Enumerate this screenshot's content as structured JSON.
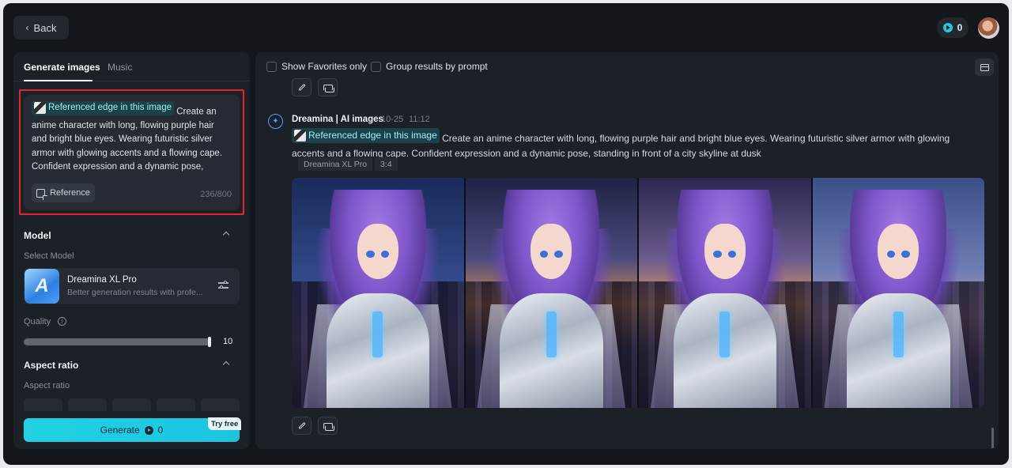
{
  "header": {
    "back_label": "Back",
    "credits": "0"
  },
  "left": {
    "tabs": [
      {
        "label": "Generate images",
        "active": true
      },
      {
        "label": "Music",
        "active": false
      }
    ],
    "prompt": {
      "reference_chip": "Referenced edge in this image",
      "text": "Create an anime character with long, flowing purple hair and bright blue eyes. Wearing futuristic silver armor with glowing accents and a flowing cape. Confident expression and a dynamic pose,",
      "reference_button": "Reference",
      "char_count": "236/800"
    },
    "model": {
      "section_title": "Model",
      "select_label": "Select Model",
      "name": "Dreamina XL Pro",
      "description": "Better generation results with profe...",
      "logo_letter": "A"
    },
    "quality": {
      "label": "Quality",
      "value": "10"
    },
    "aspect": {
      "section_title": "Aspect ratio",
      "label": "Aspect ratio"
    },
    "generate": {
      "label": "Generate",
      "cost": "0",
      "badge": "Try free"
    }
  },
  "right": {
    "filters": {
      "favorites_label": "Show Favorites only",
      "group_label": "Group results by prompt"
    },
    "result": {
      "bot_name": "Dreamina | AI images",
      "date": "10-25",
      "time": "11:12",
      "reference_chip": "Referenced edge in this image",
      "prompt": "Create an anime character with long, flowing purple hair and bright blue eyes. Wearing futuristic silver armor with glowing accents and a flowing cape. Confident expression and a dynamic pose, standing in front of a city skyline at dusk",
      "tags": [
        "Dreamina XL Pro",
        "3:4"
      ]
    }
  },
  "colors": {
    "accent": "#22d1e5",
    "highlight_border": "#e2262a",
    "panel_bg": "#1c2027",
    "app_bg": "#13161b"
  }
}
